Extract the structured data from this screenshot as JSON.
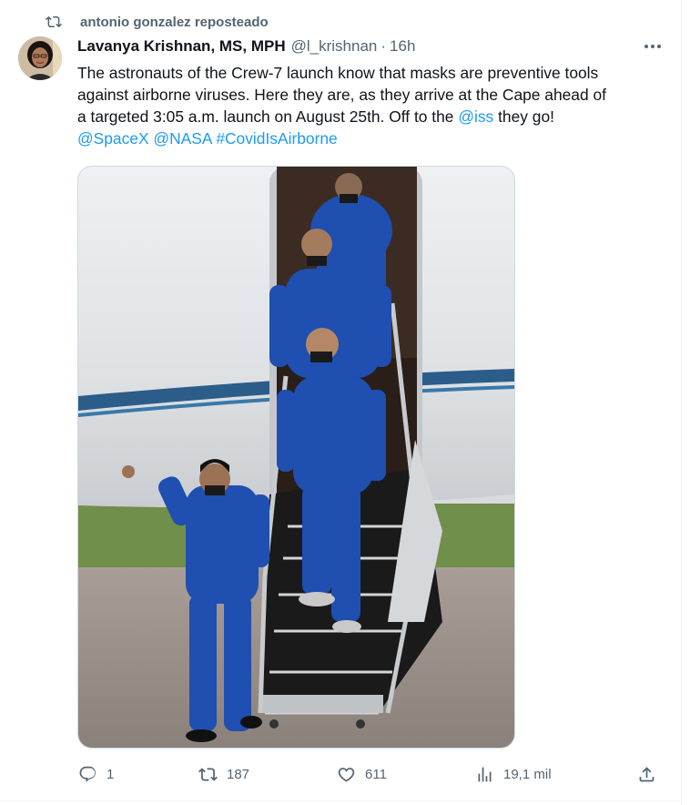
{
  "repost": {
    "label": "antonio gonzalez reposteado"
  },
  "author": {
    "name": "Lavanya Krishnan, MS, MPH",
    "handle": "@l_krishnan",
    "time": "16h"
  },
  "tweet": {
    "line1": "The astronauts of the Crew-7 launch know that masks are preventive tools",
    "line2": "against airborne viruses. Here they are, as they arrive at the Cape ahead of",
    "line3_pre": "a targeted 3:05 a.m. launch on August 25th. Off to the ",
    "line3_link": "@iss",
    "line3_post": " they go!",
    "mention1": "@SpaceX",
    "mention2": "@NASA",
    "hashtag": "#CovidIsAirborne"
  },
  "actions": {
    "replies": "1",
    "reposts": "187",
    "likes": "611",
    "views": "19,1 mil"
  },
  "colors": {
    "link": "#1d9bf0",
    "secondary": "#536471",
    "suit": "#1f4fb0"
  },
  "icons": [
    "repost-icon",
    "more-icon",
    "reply-icon",
    "like-icon",
    "views-icon",
    "share-icon"
  ]
}
